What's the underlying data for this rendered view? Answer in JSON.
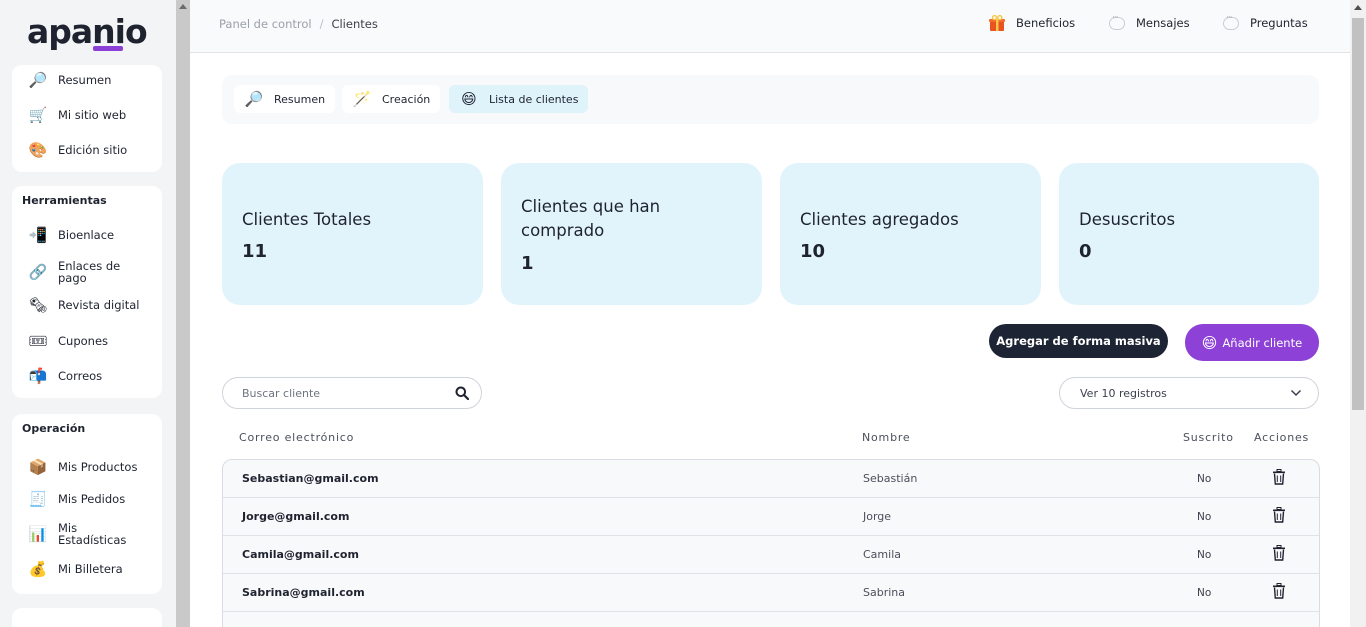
{
  "sidebar": {
    "logo": "apanio",
    "main_items": [
      {
        "label": "Resumen",
        "icon": "🔎"
      },
      {
        "label": "Mi sitio web",
        "icon": "🛒"
      },
      {
        "label": "Edición sitio",
        "icon": "🎨"
      }
    ],
    "herramientas": {
      "heading": "Herramientas",
      "items": [
        {
          "label": "Bioenlace",
          "icon": "📲"
        },
        {
          "label": "Enlaces de pago",
          "icon": "🔗"
        },
        {
          "label": "Revista digital",
          "icon": "🗞"
        },
        {
          "label": "Cupones",
          "icon": "🎟"
        },
        {
          "label": "Correos",
          "icon": "📬"
        }
      ]
    },
    "operacion": {
      "heading": "Operación",
      "items": [
        {
          "label": "Mis Productos",
          "icon": "📦"
        },
        {
          "label": "Mis Pedidos",
          "icon": "🧾"
        },
        {
          "label": "Mis Estadísticas",
          "icon": "📊"
        },
        {
          "label": "Mi Billetera",
          "icon": "💰"
        }
      ]
    }
  },
  "header": {
    "breadcrumb": [
      "Panel de control",
      "Clientes"
    ],
    "nav": [
      {
        "label": "Beneficios",
        "icon": "gift-icon"
      },
      {
        "label": "Mensajes",
        "icon": "chat-bubble-icon"
      },
      {
        "label": "Preguntas",
        "icon": "chat-bubble-icon"
      }
    ]
  },
  "tabs": [
    {
      "label": "Resumen",
      "icon": "🔎"
    },
    {
      "label": "Creación",
      "icon": "🪄"
    },
    {
      "label": "Lista de clientes",
      "icon": "😄",
      "active": true
    }
  ],
  "stats": [
    {
      "title": "Clientes Totales",
      "value": "11"
    },
    {
      "title": "Clientes que han comprado",
      "value": "1"
    },
    {
      "title": "Clientes agregados",
      "value": "10"
    },
    {
      "title": "Desuscritos",
      "value": "0"
    }
  ],
  "actions": {
    "bulk_label": "Agregar de forma masiva",
    "add_label": "Añadir cliente",
    "add_icon": "😄"
  },
  "search": {
    "placeholder": "Buscar cliente"
  },
  "page_size": {
    "label": "Ver 10 registros"
  },
  "table": {
    "headers": {
      "email": "Correo electrónico",
      "name": "Nombre",
      "subscribed": "Suscrito",
      "actions": "Acciones"
    },
    "rows": [
      {
        "email": "Sebastian@gmail.com",
        "name": "Sebastián",
        "subscribed": "No"
      },
      {
        "email": "Jorge@gmail.com",
        "name": "Jorge",
        "subscribed": "No"
      },
      {
        "email": "Camila@gmail.com",
        "name": "Camila",
        "subscribed": "No"
      },
      {
        "email": "Sabrina@gmail.com",
        "name": "Sabrina",
        "subscribed": "No"
      }
    ]
  },
  "colors": {
    "accent_purple": "#8d41d6",
    "dark_button": "#1d2433",
    "stat_card": "#e1f4fc"
  }
}
